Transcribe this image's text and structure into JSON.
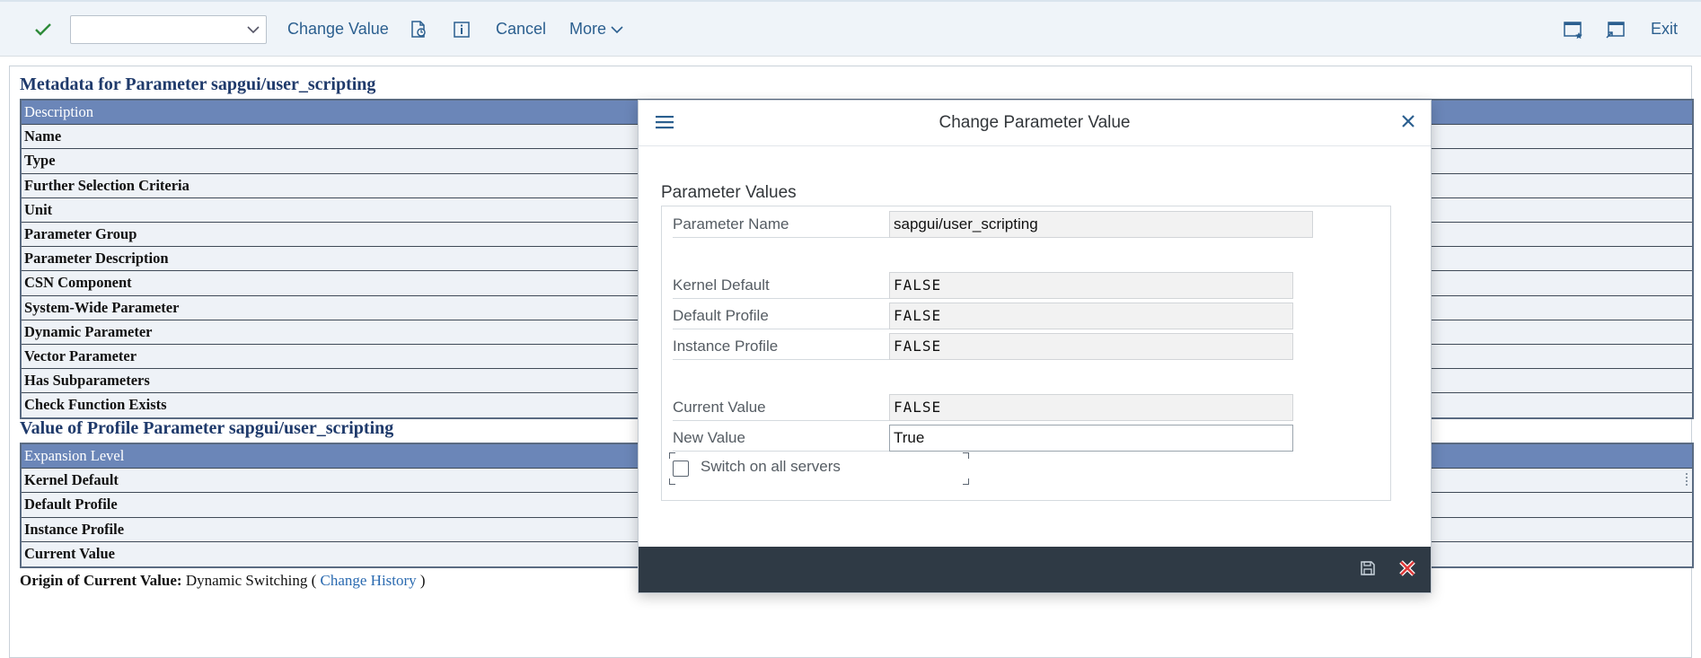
{
  "toolbar": {
    "command_field": {
      "value": "",
      "placeholder": ""
    },
    "change_value": "Change Value",
    "cancel": "Cancel",
    "more": "More",
    "exit": "Exit",
    "icons": [
      "checkmark-icon",
      "chevron-down-icon",
      "display-change-icon",
      "info-icon",
      "new-window-icon",
      "window-icon"
    ]
  },
  "metadata": {
    "title": "Metadata for Parameter sapgui/user_scripting",
    "header": "Description",
    "rows": [
      "Name",
      "Type",
      "Further Selection Criteria",
      "Unit",
      "Parameter Group",
      "Parameter Description",
      "CSN Component",
      "System-Wide Parameter",
      "Dynamic Parameter",
      "Vector Parameter",
      "Has Subparameters",
      "Check Function Exists"
    ]
  },
  "profile_value": {
    "title": "Value of Profile Parameter sapgui/user_scripting",
    "header": "Expansion Level",
    "rows": [
      "Kernel Default",
      "Default Profile",
      "Instance Profile",
      "Current Value"
    ]
  },
  "origin": {
    "label": "Origin of Current Value:",
    "value": "Dynamic Switching (",
    "link": "Change History",
    "close": ")"
  },
  "dialog": {
    "title": "Change Parameter Value",
    "group_title": "Parameter Values",
    "parameter_name_label": "Parameter Name",
    "parameter_name_value": "sapgui/user_scripting",
    "kernel_default_label": "Kernel Default",
    "kernel_default_value": "FALSE",
    "default_profile_label": "Default Profile",
    "default_profile_value": "FALSE",
    "instance_profile_label": "Instance Profile",
    "instance_profile_value": "FALSE",
    "current_value_label": "Current Value",
    "current_value_value": "FALSE",
    "new_value_label": "New Value",
    "new_value_value": "True",
    "switch_all_label": "Switch on all servers",
    "switch_all_checked": false,
    "footer_icons": [
      "save-icon",
      "cancel-icon"
    ]
  }
}
